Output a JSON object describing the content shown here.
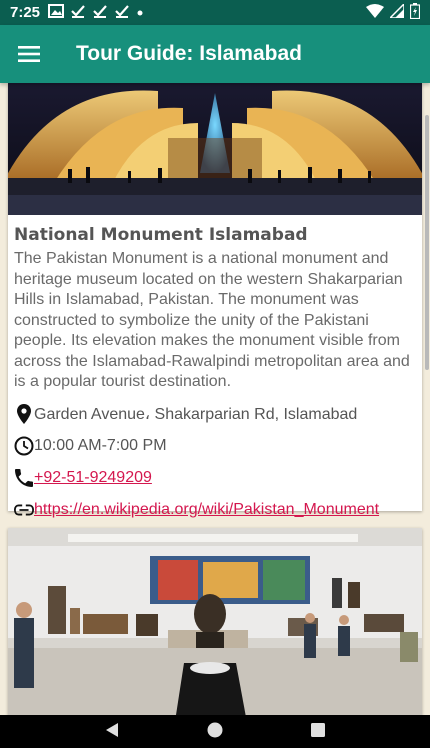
{
  "status_bar": {
    "time": "7:25",
    "icons": [
      "image-icon",
      "check-icon",
      "check-icon",
      "check-icon",
      "dot-icon"
    ],
    "right_icons": [
      "wifi-icon",
      "signal-icon",
      "battery-icon"
    ]
  },
  "app_bar": {
    "title": "Tour Guide: Islamabad",
    "menu_icon": "hamburger-menu-icon",
    "color": "#17907c",
    "status_color": "#0b5e50"
  },
  "places": [
    {
      "name": "National Monument Islamabad",
      "description": "The Pakistan Monument is a national monument and heritage museum located on the western Shakarparian Hills in Islamabad, Pakistan. The monument was constructed to symbolize the unity of the Pakistani people. Its elevation makes the monument visible from across the Islamabad-Rawalpindi metropolitan area and is a popular tourist destination.",
      "address": "Garden Avenue، Shakarparian Rd, Islamabad",
      "hours": "10:00 AM-7:00 PM",
      "phone": "+92-51-9249209",
      "website": "https://en.wikipedia.org/wiki/Pakistan_Monument"
    }
  ],
  "colors": {
    "link": "#d4174e",
    "background": "#f3ecdc"
  }
}
